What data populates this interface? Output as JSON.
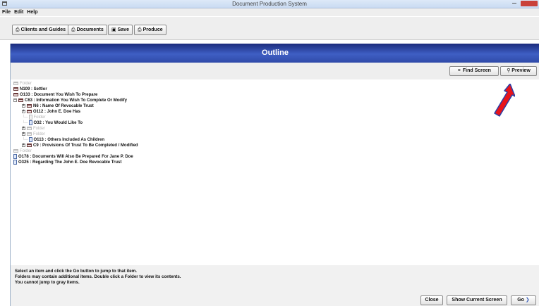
{
  "window": {
    "title": "Document Production System"
  },
  "menu": [
    "File",
    "Edit",
    "Help"
  ],
  "toolbar": {
    "clients": {
      "icon": "printer-icon",
      "label": "Clients and Guides"
    },
    "documents": {
      "icon": "printer-icon",
      "label": "Documents"
    },
    "save": {
      "icon": "disk-icon",
      "label": "Save"
    },
    "produce": {
      "icon": "printer-icon",
      "label": "Produce"
    }
  },
  "outline": {
    "title": "Outline",
    "find_screen": "Find Screen",
    "preview": "Preview",
    "tree": [
      {
        "label": "Folder",
        "type": "folder",
        "gray": true
      },
      {
        "label": "N109 : Settlor",
        "type": "folder"
      },
      {
        "label": "O133 : Document You Wish To Prepare",
        "type": "folder"
      },
      {
        "label": "C63 : Information You Wish To Complete Or Modify",
        "type": "folder",
        "expanded": true
      },
      {
        "label": "N6 : Name Of Revocable Trust",
        "type": "folder",
        "collapsed": true
      },
      {
        "label": "O112 : John E. Doe Has",
        "type": "folder",
        "collapsed": true
      },
      {
        "label": "Folder",
        "type": "doc",
        "gray": true
      },
      {
        "label": "O32 : You Would Like To",
        "type": "doc"
      },
      {
        "label": "Folder",
        "type": "folder",
        "gray": true,
        "collapsed": true
      },
      {
        "label": "Folder",
        "type": "folder",
        "gray": true,
        "collapsed": true
      },
      {
        "label": "O113 : Others Included As Children",
        "type": "doc"
      },
      {
        "label": "C9 : Provisions Of Trust To Be Completed / Modified",
        "type": "folder",
        "collapsed": true
      },
      {
        "label": "Folder",
        "type": "folder",
        "gray": true
      },
      {
        "label": "O178 : Documents Will Also Be Prepared For Jane P. Doe",
        "type": "doc"
      },
      {
        "label": "O325 : Regarding The John E. Doe Revocable Trust",
        "type": "doc"
      }
    ],
    "hints": [
      "Select an item and click the Go button to jump to that item.",
      "Folders may contain additional items. Double click a Folder to view its contents.",
      "You cannot jump to gray items."
    ],
    "close": "Close",
    "show_current": "Show Current Screen",
    "go": "Go"
  },
  "annotation": {
    "color": "#e8141a",
    "outline": "#2a3fa8"
  }
}
